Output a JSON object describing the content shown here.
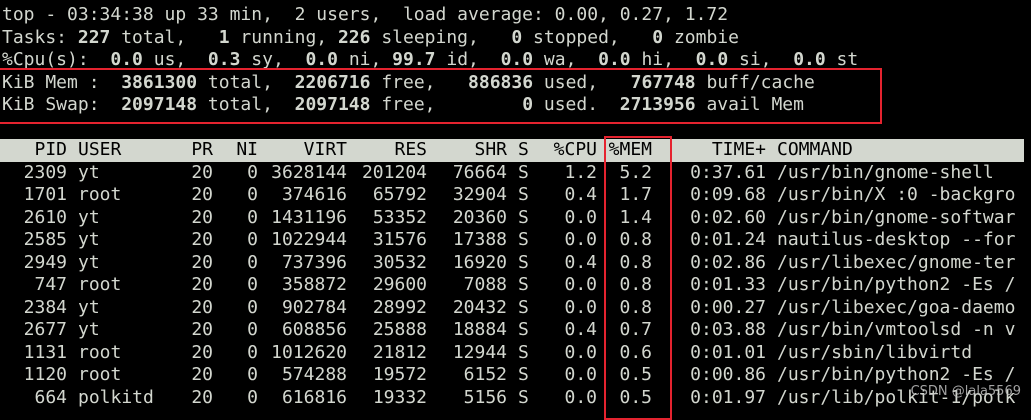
{
  "summary": {
    "line1": {
      "uptime": "top - 03:34:38 up 33 min,  2 users,  load average: 0.00, 0.27, 1.72"
    },
    "tasks": {
      "label": "Tasks: ",
      "total": "227",
      "total_label": " total,   ",
      "running": "1",
      "running_label": " running, ",
      "sleeping": "226",
      "sleeping_label": " sleeping,   ",
      "stopped": "0",
      "stopped_label": " stopped,   ",
      "zombie": "0",
      "zombie_label": " zombie"
    },
    "cpu": {
      "label": "%Cpu(s):  ",
      "us": "0.0",
      "us_label": " us,  ",
      "sy": "0.3",
      "sy_label": " sy,  ",
      "ni": "0.0",
      "ni_label": " ni, ",
      "id": "99.7",
      "id_label": " id,  ",
      "wa": "0.0",
      "wa_label": " wa,  ",
      "hi": "0.0",
      "hi_label": " hi,  ",
      "si": "0.0",
      "si_label": " si,  ",
      "st": "0.0",
      "st_label": " st"
    },
    "mem": {
      "label": "KiB Mem :  ",
      "total": "3861300",
      "total_label": " total,  ",
      "free": "2206716",
      "free_label": " free,   ",
      "used": "886836",
      "used_label": " used,   ",
      "buff": "767748",
      "buff_label": " buff/cache"
    },
    "swap": {
      "label": "KiB Swap:  ",
      "total": "2097148",
      "total_label": " total,  ",
      "free": "2097148",
      "free_label": " free,        ",
      "used": "0",
      "used_label": " used.  ",
      "avail": "2713956",
      "avail_label": " avail Mem"
    }
  },
  "columns": {
    "pid": "PID",
    "user": "USER",
    "pr": "PR",
    "ni": "NI",
    "virt": "VIRT",
    "res": "RES",
    "shr": "SHR",
    "s": "S",
    "cpu": "%CPU",
    "mem": "%MEM",
    "time": "TIME+",
    "command": "COMMAND"
  },
  "processes": [
    {
      "pid": "2309",
      "user": "yt",
      "pr": "20",
      "ni": "0",
      "virt": "3628144",
      "res": "201204",
      "shr": "76664",
      "s": "S",
      "cpu": "1.2",
      "mem": "5.2",
      "time": "0:37.61",
      "command": "/usr/bin/gnome-shell"
    },
    {
      "pid": "1701",
      "user": "root",
      "pr": "20",
      "ni": "0",
      "virt": "374616",
      "res": "65792",
      "shr": "32904",
      "s": "S",
      "cpu": "0.4",
      "mem": "1.7",
      "time": "0:09.68",
      "command": "/usr/bin/X :0 -backgro"
    },
    {
      "pid": "2610",
      "user": "yt",
      "pr": "20",
      "ni": "0",
      "virt": "1431196",
      "res": "53352",
      "shr": "20360",
      "s": "S",
      "cpu": "0.0",
      "mem": "1.4",
      "time": "0:02.60",
      "command": "/usr/bin/gnome-softwar"
    },
    {
      "pid": "2585",
      "user": "yt",
      "pr": "20",
      "ni": "0",
      "virt": "1022944",
      "res": "31576",
      "shr": "17388",
      "s": "S",
      "cpu": "0.0",
      "mem": "0.8",
      "time": "0:01.24",
      "command": "nautilus-desktop --for"
    },
    {
      "pid": "2949",
      "user": "yt",
      "pr": "20",
      "ni": "0",
      "virt": "737396",
      "res": "30532",
      "shr": "16920",
      "s": "S",
      "cpu": "0.4",
      "mem": "0.8",
      "time": "0:02.86",
      "command": "/usr/libexec/gnome-ter"
    },
    {
      "pid": "747",
      "user": "root",
      "pr": "20",
      "ni": "0",
      "virt": "358872",
      "res": "29600",
      "shr": "7088",
      "s": "S",
      "cpu": "0.0",
      "mem": "0.8",
      "time": "0:01.33",
      "command": "/usr/bin/python2 -Es /"
    },
    {
      "pid": "2384",
      "user": "yt",
      "pr": "20",
      "ni": "0",
      "virt": "902784",
      "res": "28992",
      "shr": "20432",
      "s": "S",
      "cpu": "0.0",
      "mem": "0.8",
      "time": "0:00.27",
      "command": "/usr/libexec/goa-daemo"
    },
    {
      "pid": "2677",
      "user": "yt",
      "pr": "20",
      "ni": "0",
      "virt": "608856",
      "res": "25888",
      "shr": "18884",
      "s": "S",
      "cpu": "0.4",
      "mem": "0.7",
      "time": "0:03.88",
      "command": "/usr/bin/vmtoolsd -n v"
    },
    {
      "pid": "1131",
      "user": "root",
      "pr": "20",
      "ni": "0",
      "virt": "1012620",
      "res": "21812",
      "shr": "12944",
      "s": "S",
      "cpu": "0.0",
      "mem": "0.6",
      "time": "0:01.01",
      "command": "/usr/sbin/libvirtd"
    },
    {
      "pid": "1120",
      "user": "root",
      "pr": "20",
      "ni": "0",
      "virt": "574288",
      "res": "19572",
      "shr": "6152",
      "s": "S",
      "cpu": "0.0",
      "mem": "0.5",
      "time": "0:00.86",
      "command": "/usr/bin/python2 -Es /"
    },
    {
      "pid": "664",
      "user": "polkitd",
      "pr": "20",
      "ni": "0",
      "virt": "616816",
      "res": "19332",
      "shr": "5156",
      "s": "S",
      "cpu": "0.0",
      "mem": "0.5",
      "time": "0:01.97",
      "command": "/usr/lib/polkit-1/polk"
    }
  ],
  "watermark": "CSDN @lala5569",
  "colors": {
    "background": "#000000",
    "foreground": "#d3d7cf",
    "header_bar": "#d3d7cf",
    "highlight": "#e5232f"
  }
}
